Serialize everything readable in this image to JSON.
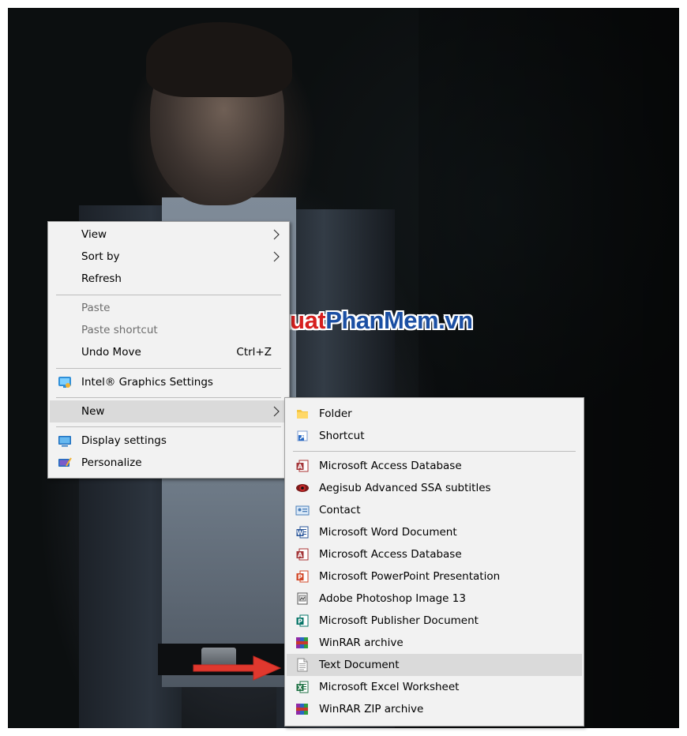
{
  "desktop_menu": {
    "items": [
      {
        "label": "View"
      },
      {
        "label": "Sort by"
      },
      {
        "label": "Refresh"
      },
      {
        "label": "Paste"
      },
      {
        "label": "Paste shortcut"
      },
      {
        "label": "Undo Move",
        "shortcut": "Ctrl+Z"
      },
      {
        "label": "Intel® Graphics Settings"
      },
      {
        "label": "New"
      },
      {
        "label": "Display settings"
      },
      {
        "label": "Personalize"
      }
    ]
  },
  "new_submenu": {
    "items": [
      {
        "label": "Folder"
      },
      {
        "label": "Shortcut"
      },
      {
        "label": "Microsoft Access Database"
      },
      {
        "label": "Aegisub Advanced SSA subtitles"
      },
      {
        "label": "Contact"
      },
      {
        "label": "Microsoft Word Document"
      },
      {
        "label": "Microsoft Access Database"
      },
      {
        "label": "Microsoft PowerPoint Presentation"
      },
      {
        "label": "Adobe Photoshop Image 13"
      },
      {
        "label": "Microsoft Publisher Document"
      },
      {
        "label": "WinRAR archive"
      },
      {
        "label": "Text Document"
      },
      {
        "label": "Microsoft Excel Worksheet"
      },
      {
        "label": "WinRAR ZIP archive"
      }
    ],
    "highlighted": "Text Document"
  },
  "watermark": {
    "part1": "ThuThuat",
    "part2": "PhanMem.vn"
  },
  "colors": {
    "menu_bg": "#f2f2f2",
    "highlight": "#dadada",
    "arrow": "#e0382e",
    "watermark_red": "#d6201f",
    "watermark_blue": "#1b4fa3"
  }
}
